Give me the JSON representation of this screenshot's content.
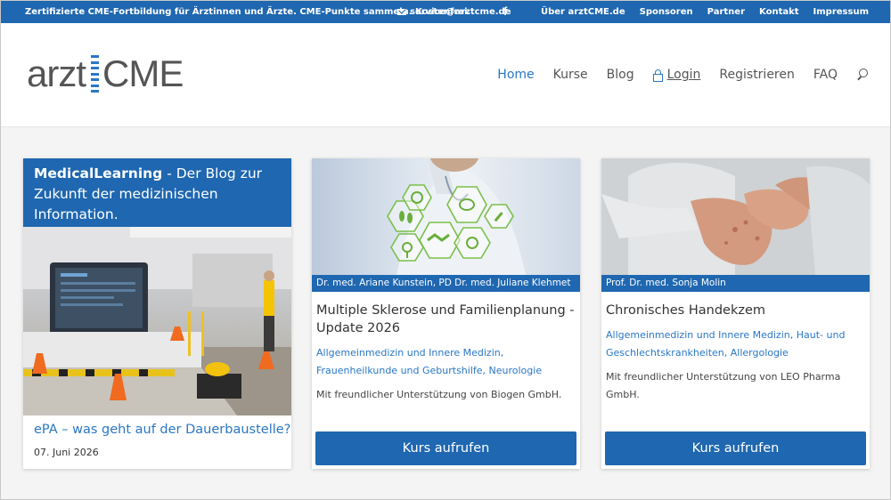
{
  "topbar": {
    "tagline": "Zertifizierte CME-Fortbildung für Ärztinnen und Ärzte. CME-Punkte sammeln. Kostenfrei.",
    "email": "service@arztcme.de",
    "facebook": "f",
    "links": [
      "Über arztCME.de",
      "Sponsoren",
      "Partner",
      "Kontakt",
      "Impressum"
    ]
  },
  "logo": {
    "part1": "arzt",
    "part2": "CME"
  },
  "nav": {
    "home": "Home",
    "kurse": "Kurse",
    "blog": "Blog",
    "login": "Login",
    "registrieren": "Registrieren",
    "faq": "FAQ"
  },
  "blog_card": {
    "header_bold": "MedicalLearning",
    "header_rest": " - Der Blog zur Zukunft der medizinischen Information.",
    "title": "ePA – was geht auf der Dauerbaustelle?",
    "date": "07. Juni 2026"
  },
  "courses": [
    {
      "authors": "Dr. med. Ariane Kunstein, PD Dr. med. Juliane Klehmet",
      "title": "Multiple Sklerose und Familienplanung - Update 2026",
      "categories": "Allgemeinmedizin und Innere Medizin, Frauenheilkunde und Geburtshilfe, Neurologie",
      "sponsor": "Mit freundlicher Unterstützung von Biogen GmbH.",
      "button": "Kurs aufrufen"
    },
    {
      "authors": "Prof. Dr. med. Sonja Molin",
      "title": "Chronisches Handekzem",
      "categories": "Allgemeinmedizin und Innere Medizin, Haut- und Geschlechtskrankheiten, Allergologie",
      "sponsor": "Mit freundlicher Unterstützung von LEO Pharma GmbH.",
      "button": "Kurs aufrufen"
    }
  ],
  "colors": {
    "brand_blue": "#1f67b0",
    "link_blue": "#2a77c4",
    "accent_green": "#7bbf4a"
  }
}
